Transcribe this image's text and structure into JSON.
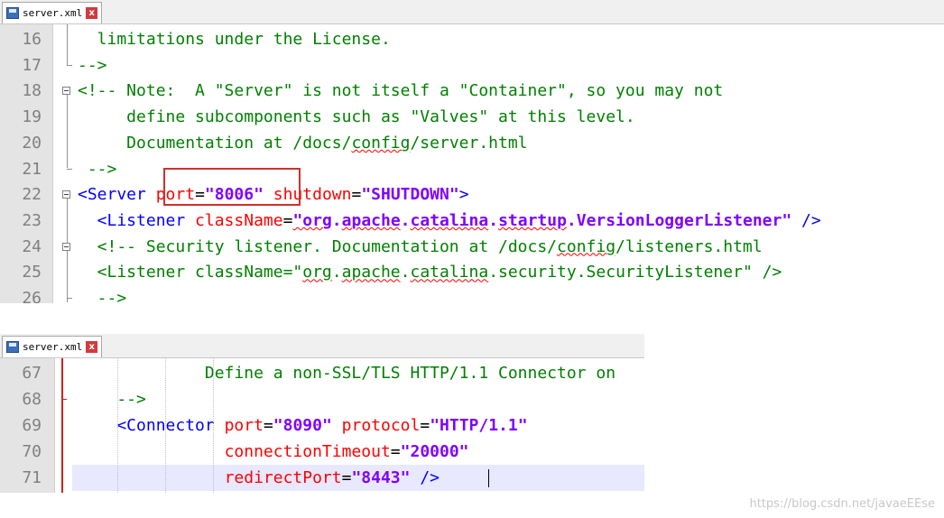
{
  "top_panel": {
    "tab": {
      "title": "server.xml",
      "close_glyph": "x"
    },
    "lines": [
      {
        "num": "16",
        "segments": [
          {
            "cls": "c-comment",
            "text": "  limitations under the License."
          }
        ]
      },
      {
        "num": "17",
        "segments": [
          {
            "cls": "c-comment",
            "text": "-->"
          }
        ]
      },
      {
        "num": "18",
        "segments": [
          {
            "cls": "c-comment",
            "text": "<!-- Note:  A \"Server\" is not itself a \"Container\", so you may not"
          }
        ]
      },
      {
        "num": "19",
        "segments": [
          {
            "cls": "c-comment",
            "text": "     define subcomponents such as \"Valves\" at this level."
          }
        ]
      },
      {
        "num": "20",
        "segments": [
          {
            "cls": "c-comment",
            "text": "     Documentation at /docs/"
          },
          {
            "cls": "c-comment squig",
            "text": "config"
          },
          {
            "cls": "c-comment",
            "text": "/server.html"
          }
        ]
      },
      {
        "num": "21",
        "segments": [
          {
            "cls": "c-comment",
            "text": " -->"
          }
        ]
      },
      {
        "num": "22",
        "segments": [
          {
            "cls": "c-tag",
            "text": "<Server "
          },
          {
            "cls": "c-attr",
            "text": "port"
          },
          {
            "cls": "c-text",
            "text": "="
          },
          {
            "cls": "c-val",
            "text": "\"8006\""
          },
          {
            "cls": "c-text",
            "text": " "
          },
          {
            "cls": "c-attr",
            "text": "shutdown"
          },
          {
            "cls": "c-text",
            "text": "="
          },
          {
            "cls": "c-val",
            "text": "\"SHUTDOWN\""
          },
          {
            "cls": "c-tag",
            "text": ">"
          }
        ]
      },
      {
        "num": "23",
        "segments": [
          {
            "cls": "c-tag",
            "text": "  <Listener "
          },
          {
            "cls": "c-attr",
            "text": "className"
          },
          {
            "cls": "c-text",
            "text": "="
          },
          {
            "cls": "c-val squig",
            "text": "\"org"
          },
          {
            "cls": "c-val",
            "text": "."
          },
          {
            "cls": "c-val squig",
            "text": "apache"
          },
          {
            "cls": "c-val",
            "text": "."
          },
          {
            "cls": "c-val squig",
            "text": "catalina"
          },
          {
            "cls": "c-val",
            "text": "."
          },
          {
            "cls": "c-val squig",
            "text": "startup"
          },
          {
            "cls": "c-val",
            "text": ".VersionLoggerListener\""
          },
          {
            "cls": "c-tag",
            "text": " />"
          }
        ]
      },
      {
        "num": "24",
        "segments": [
          {
            "cls": "c-comment",
            "text": "  <!-- Security listener. Documentation at /docs/"
          },
          {
            "cls": "c-comment squig",
            "text": "config"
          },
          {
            "cls": "c-comment",
            "text": "/listeners.html"
          }
        ]
      },
      {
        "num": "25",
        "segments": [
          {
            "cls": "c-comment",
            "text": "  <Listener className=\""
          },
          {
            "cls": "c-comment squig",
            "text": "org"
          },
          {
            "cls": "c-comment",
            "text": "."
          },
          {
            "cls": "c-comment squig",
            "text": "apache"
          },
          {
            "cls": "c-comment",
            "text": "."
          },
          {
            "cls": "c-comment squig",
            "text": "catalina"
          },
          {
            "cls": "c-comment",
            "text": ".security.SecurityListener\" />"
          }
        ]
      },
      {
        "num": "26",
        "segments": [
          {
            "cls": "c-comment",
            "text": "  -->"
          }
        ]
      }
    ]
  },
  "bottom_panel": {
    "tab": {
      "title": "server.xml",
      "close_glyph": "x"
    },
    "lines": [
      {
        "num": "67",
        "segments": [
          {
            "cls": "c-comment",
            "text": "             Define a non-SSL/TLS HTTP/1.1 Connector on"
          }
        ]
      },
      {
        "num": "68",
        "segments": [
          {
            "cls": "c-comment",
            "text": "    -->"
          }
        ]
      },
      {
        "num": "69",
        "segments": [
          {
            "cls": "c-tag",
            "text": "    <Connector "
          },
          {
            "cls": "c-attr",
            "text": "port"
          },
          {
            "cls": "c-text",
            "text": "="
          },
          {
            "cls": "c-val",
            "text": "\"8090\""
          },
          {
            "cls": "c-text",
            "text": " "
          },
          {
            "cls": "c-attr",
            "text": "protocol"
          },
          {
            "cls": "c-text",
            "text": "="
          },
          {
            "cls": "c-val",
            "text": "\"HTTP/1.1\""
          }
        ]
      },
      {
        "num": "70",
        "segments": [
          {
            "cls": "c-text",
            "text": "               "
          },
          {
            "cls": "c-attr",
            "text": "connectionTimeout"
          },
          {
            "cls": "c-text",
            "text": "="
          },
          {
            "cls": "c-val",
            "text": "\"20000\""
          }
        ]
      },
      {
        "num": "71",
        "segments": [
          {
            "cls": "c-text",
            "text": "               "
          },
          {
            "cls": "c-attr",
            "text": "redirectPort"
          },
          {
            "cls": "c-text",
            "text": "="
          },
          {
            "cls": "c-val",
            "text": "\"8443\""
          },
          {
            "cls": "c-text",
            "text": " "
          },
          {
            "cls": "c-tag",
            "text": "/>"
          }
        ]
      }
    ]
  },
  "watermark": "https://blog.csdn.net/javaeEEse",
  "colors": {
    "comment": "#008000",
    "tag": "#0000ff",
    "attr": "#ff0000",
    "value": "#8000ff",
    "highlight": "#d0312d"
  }
}
